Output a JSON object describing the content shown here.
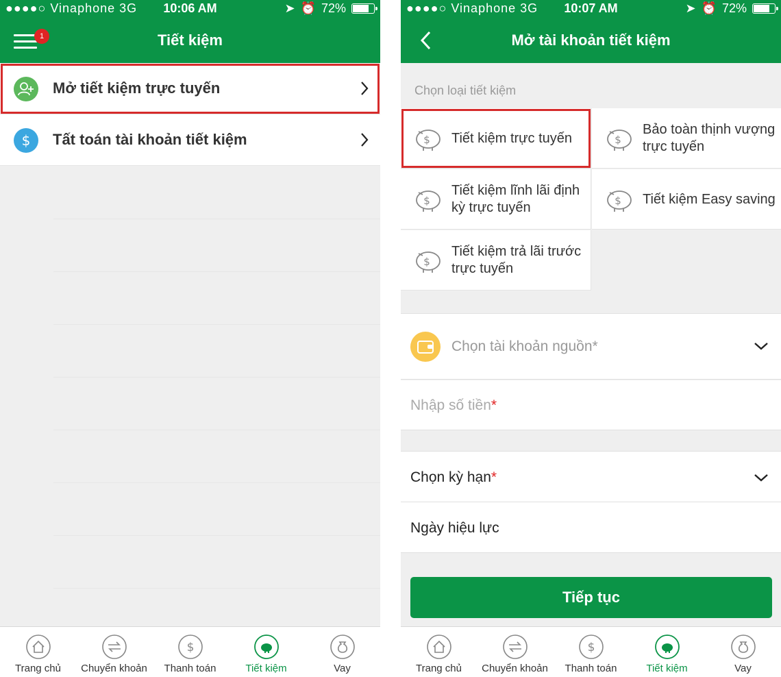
{
  "colors": {
    "brand": "#0b9447",
    "highlight": "#d62b2b",
    "badge": "#e02424"
  },
  "left_screen": {
    "status": {
      "signal": "●●●●○ Vinaphone   3G",
      "time": "10:06 AM",
      "battery": "72%"
    },
    "header": {
      "title": "Tiết kiệm",
      "badge_count": "1"
    },
    "menu_items": [
      {
        "label": "Mở tiết kiệm trực tuyến",
        "icon": "add-user-icon",
        "highlighted": true
      },
      {
        "label": "Tất toán tài khoản tiết kiệm",
        "icon": "dollar-icon",
        "highlighted": false
      }
    ]
  },
  "right_screen": {
    "status": {
      "signal": "●●●●○ Vinaphone   3G",
      "time": "10:07 AM",
      "battery": "72%"
    },
    "header": {
      "title": "Mở tài khoản tiết kiệm"
    },
    "section_label": "Chọn loại tiết kiệm",
    "savings_types": [
      {
        "label": "Tiết kiệm trực tuyến",
        "selected": true
      },
      {
        "label": "Bảo toàn thịnh vượng trực tuyến",
        "selected": false
      },
      {
        "label": "Tiết kiệm lĩnh lãi định kỳ trực tuyến",
        "selected": false
      },
      {
        "label": "Tiết kiệm Easy saving",
        "selected": false
      },
      {
        "label": "Tiết kiệm trả lãi trước trực tuyến",
        "selected": false
      }
    ],
    "source_account": {
      "placeholder": "Chọn tài khoản nguồn*"
    },
    "amount": {
      "placeholder": "Nhập số tiền",
      "required_mark": "*"
    },
    "term": {
      "label": "Chọn kỳ hạn",
      "required_mark": "*"
    },
    "effective_date": {
      "label": "Ngày hiệu lực"
    },
    "continue_label": "Tiếp tục"
  },
  "tabbar": {
    "tabs": [
      {
        "label": "Trang chủ",
        "icon": "home-icon"
      },
      {
        "label": "Chuyển khoản",
        "icon": "transfer-icon"
      },
      {
        "label": "Thanh toán",
        "icon": "dollar-icon"
      },
      {
        "label": "Tiết kiệm",
        "icon": "piggy-bank-icon",
        "active": true
      },
      {
        "label": "Vay",
        "icon": "money-bag-icon"
      }
    ]
  }
}
